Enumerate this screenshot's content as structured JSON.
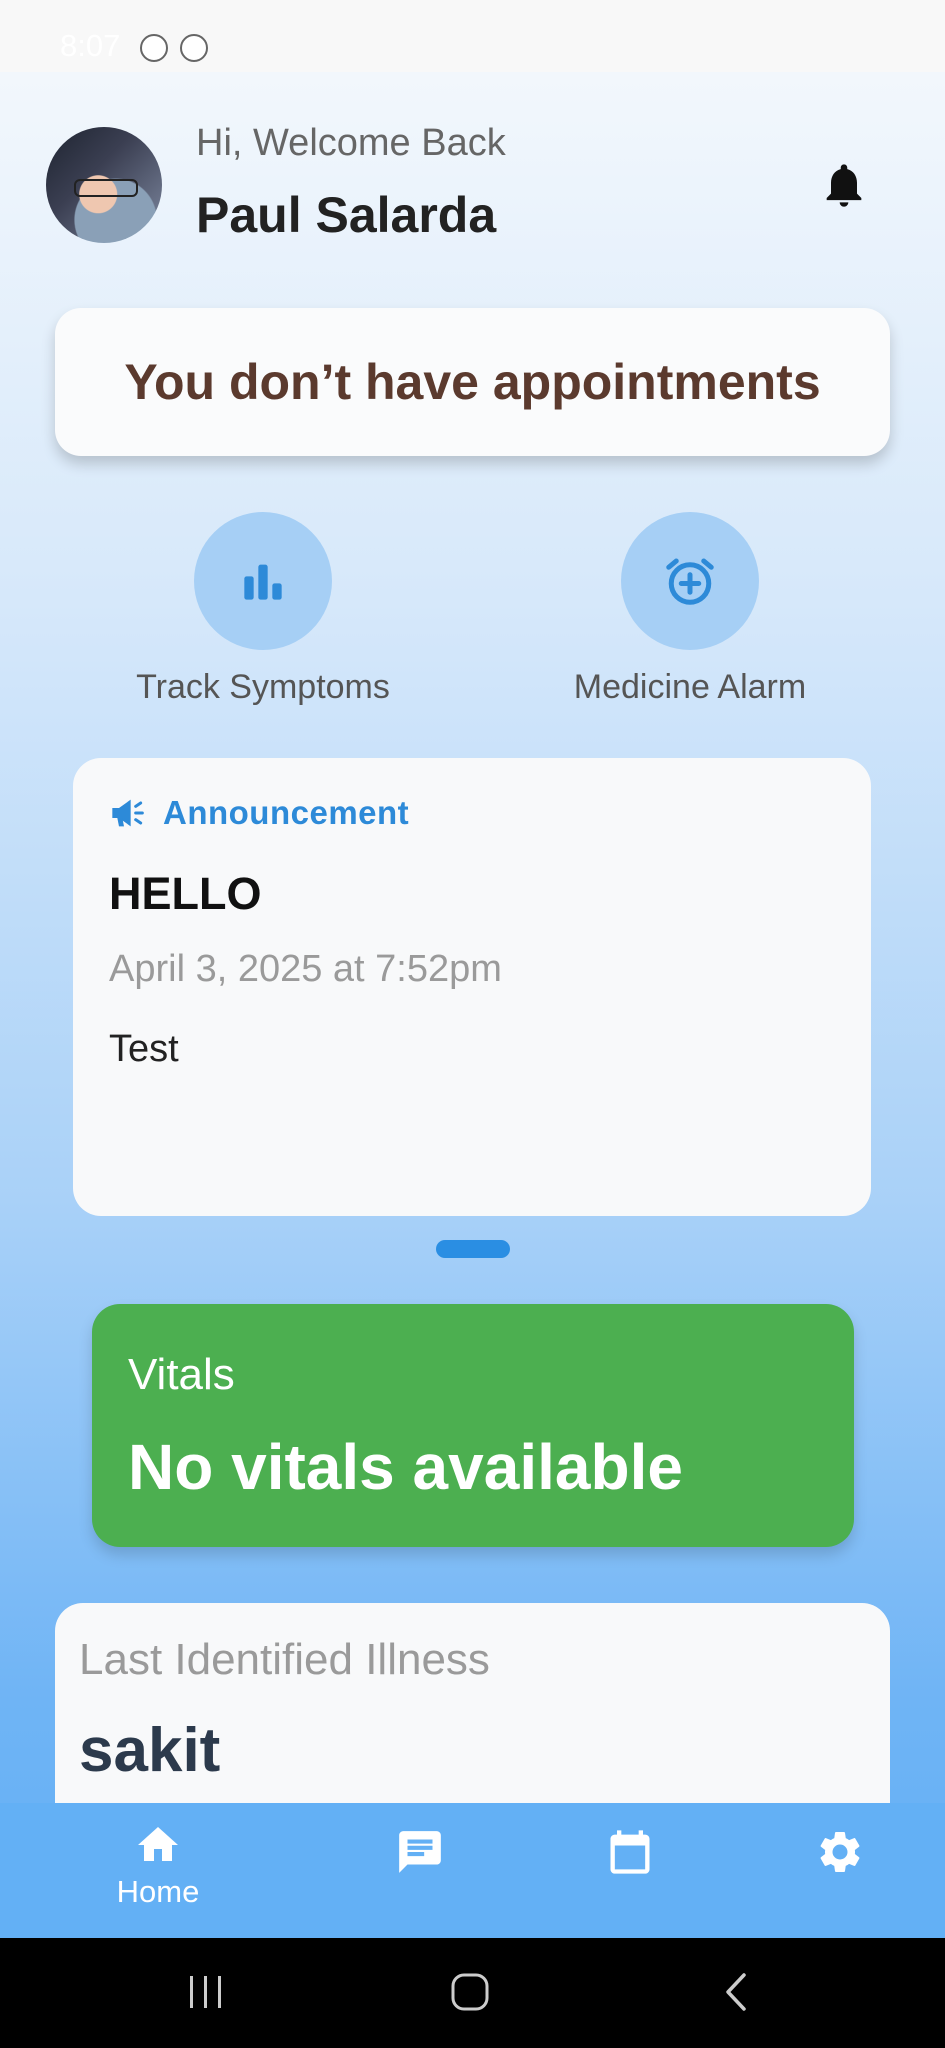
{
  "status_bar": {
    "time": "8:07"
  },
  "header": {
    "greeting": "Hi, Welcome Back",
    "user_name": "Paul Salarda",
    "avatar_icon": "user-avatar",
    "notification_icon": "bell-icon"
  },
  "appointments": {
    "message": "You don’t have appointments"
  },
  "quick_actions": [
    {
      "label": "Track Symptoms",
      "icon": "bar-chart-icon"
    },
    {
      "label": "Medicine Alarm",
      "icon": "alarm-add-icon"
    }
  ],
  "announcement": {
    "header_label": "Announcement",
    "icon": "megaphone-icon",
    "title": "HELLO",
    "date": "April 3, 2025 at 7:52pm",
    "body": "Test"
  },
  "vitals": {
    "label": "Vitals",
    "value": "No vitals available"
  },
  "illness": {
    "label": "Last Identified Illness",
    "value": "sakit"
  },
  "bottom_nav": [
    {
      "label": "Home",
      "icon": "home-icon",
      "active": true
    },
    {
      "label": "",
      "icon": "chat-icon"
    },
    {
      "label": "",
      "icon": "calendar-icon"
    },
    {
      "label": "",
      "icon": "settings-icon"
    }
  ],
  "colors": {
    "accent_blue": "#2d8ad8",
    "vitals_green": "#4caf50",
    "appointment_text": "#5b3a2e",
    "nav_bar": "#63b0f5"
  }
}
